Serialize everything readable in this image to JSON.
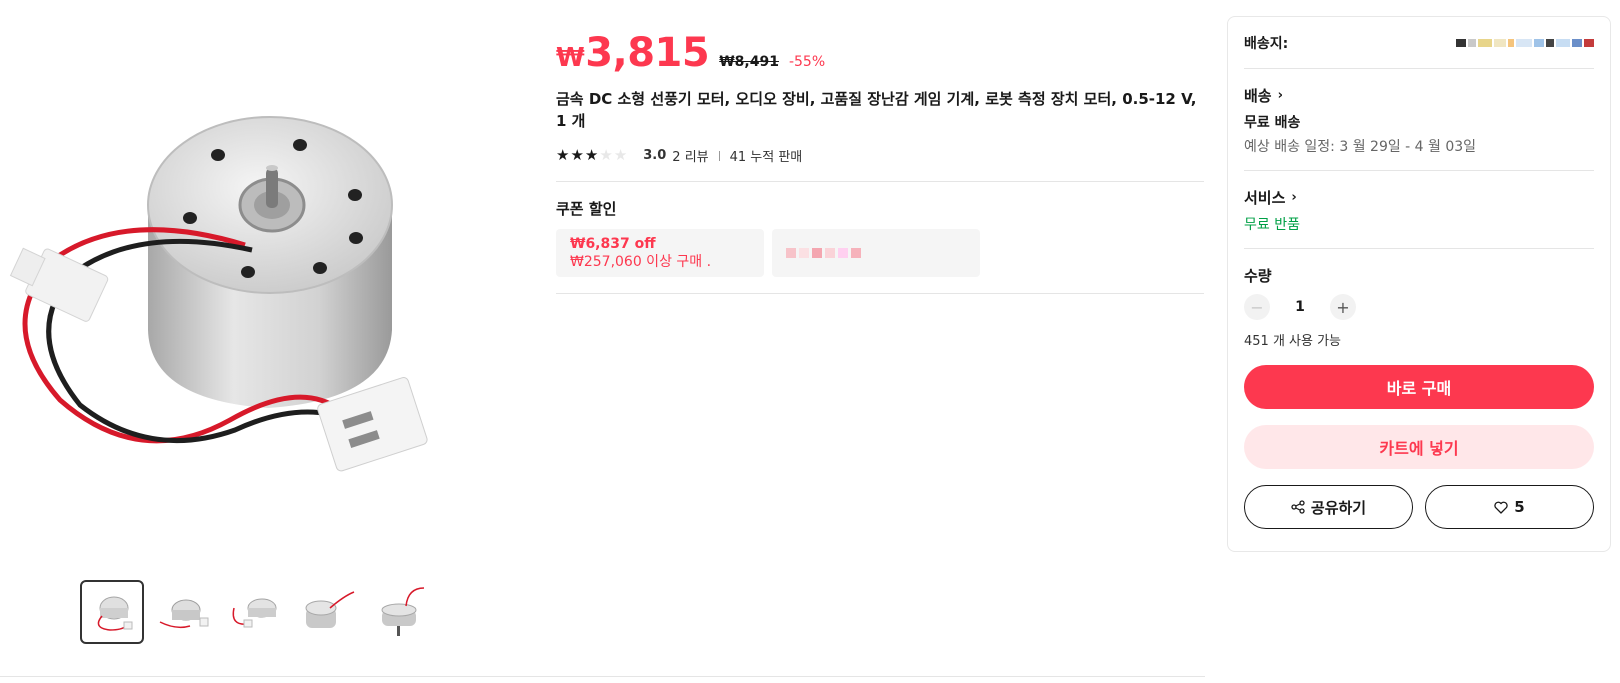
{
  "product": {
    "price_currency": "₩",
    "price_now": "3,815",
    "price_original": "₩8,491",
    "discount": "-55%",
    "title": "금속 DC 소형 선풍기 모터, 오디오 장비, 고품질 장난감 게임 기계, 로봇 측정 장치 모터, 0.5-12 V, 1 개",
    "rating": {
      "stars_filled": 3,
      "stars_total": 5,
      "score": "3.0",
      "reviews": "2 리뷰",
      "sold": "41 누적 판매"
    }
  },
  "coupons": {
    "heading": "쿠폰 할인",
    "items": [
      {
        "main": "₩6,837 off",
        "sub": "₩257,060 이상 구매 ."
      }
    ]
  },
  "gallery": {
    "main_image": "dc-motor-image",
    "thumbnails": [
      "motor-top-view",
      "motor-side-view-1",
      "motor-side-view-2",
      "motor-angle-view",
      "motor-bottom-view"
    ],
    "active_index": 0
  },
  "purchase_card": {
    "ship_to_label": "배송지:",
    "delivery": {
      "title": "배송",
      "type": "무료 배송",
      "estimate": "예상 배송 일정: 3 월 29일 - 4 월 03일"
    },
    "service": {
      "title": "서비스",
      "note": "무료 반품"
    },
    "quantity": {
      "label": "수량",
      "value": "1",
      "minus": "−",
      "plus": "+",
      "available": "451 개 사용 가능"
    },
    "buy_now": "바로 구매",
    "add_to_cart": "카트에 넣기",
    "share": "공유하기",
    "wishlist_count": "5"
  },
  "colors": {
    "accent": "#fd384f",
    "accent_light": "#ffe7e9",
    "green": "#00a046"
  }
}
